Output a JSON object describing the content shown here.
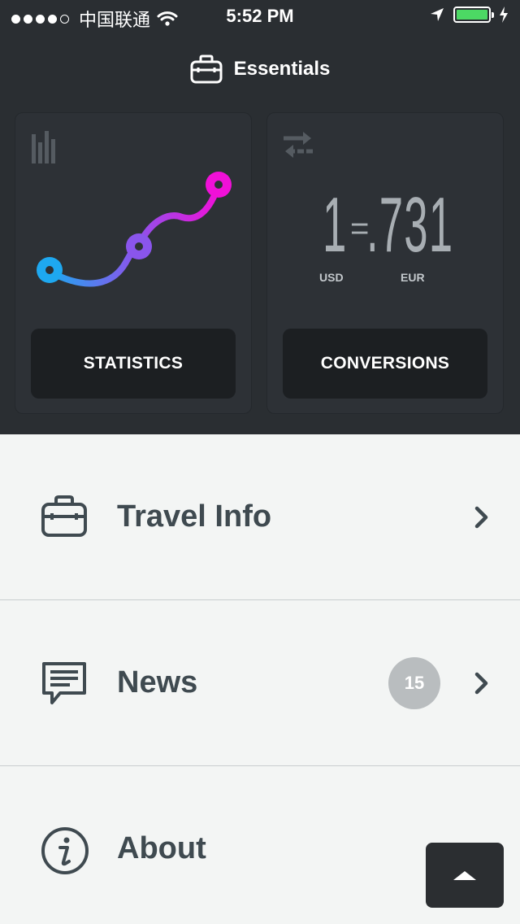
{
  "status_bar": {
    "carrier": "中国联通",
    "time": "5:52 PM"
  },
  "header": {
    "title": "Essentials",
    "icon": "briefcase-icon"
  },
  "cards": {
    "statistics": {
      "icon": "bar-chart-icon",
      "button_label": "STATISTICS"
    },
    "conversions": {
      "icon": "swap-arrows-icon",
      "from_amount": "1",
      "equals": "=",
      "to_amount": ".731",
      "from_currency": "USD",
      "to_currency": "EUR",
      "button_label": "CONVERSIONS"
    }
  },
  "menu": [
    {
      "label": "Travel Info",
      "icon": "briefcase-icon"
    },
    {
      "label": "News",
      "icon": "speech-bubble-icon",
      "badge": "15"
    },
    {
      "label": "About",
      "icon": "info-icon"
    }
  ],
  "colors": {
    "dark_bg": "#2a2e32",
    "light_bg": "#f3f5f4",
    "battery": "#4cd964",
    "gradient_start": "#1ea8f0",
    "gradient_mid": "#8a55ec",
    "gradient_end": "#f010d8"
  }
}
